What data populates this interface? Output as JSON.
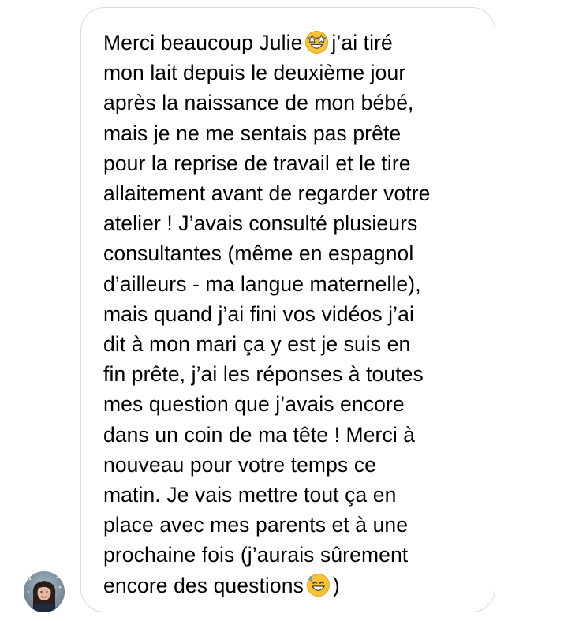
{
  "message": {
    "lines": [
      {
        "before": "Merci beaucoup Julie",
        "emoji": "star-struck-emoji",
        "after": "j’ai tiré"
      },
      {
        "text": "mon lait depuis le deuxième jour"
      },
      {
        "text": "après la naissance de mon bébé,"
      },
      {
        "text": "mais je ne me sentais pas prête"
      },
      {
        "text": "pour la reprise de travail et le tire"
      },
      {
        "text": "allaitement avant de regarder votre"
      },
      {
        "text": "atelier ! J’avais consulté plusieurs"
      },
      {
        "text": "consultantes (même en espagnol"
      },
      {
        "text": "d’ailleurs - ma langue maternelle),"
      },
      {
        "text": "mais quand j’ai fini vos vidéos j’ai"
      },
      {
        "text": "dit à mon mari ça y est je suis en"
      },
      {
        "text": "fin prête, j’ai les réponses à toutes"
      },
      {
        "text": "mes question que j’avais encore"
      },
      {
        "text": "dans un coin de ma tête ! Merci à"
      },
      {
        "text": "nouveau pour votre temps ce"
      },
      {
        "text": "matin. Je vais mettre tout ça en"
      },
      {
        "text": "place avec mes parents et à une"
      },
      {
        "text": "prochaine fois (j’aurais sûrement"
      },
      {
        "before": "encore des questions",
        "emoji": "grinning-sweat-emoji",
        "after": ")"
      }
    ]
  },
  "sender": {
    "avatar_icon": "user-avatar"
  },
  "colors": {
    "bubble_border": "#dbdbdb",
    "text": "#000000",
    "emoji_yellow": "#f7c233"
  }
}
